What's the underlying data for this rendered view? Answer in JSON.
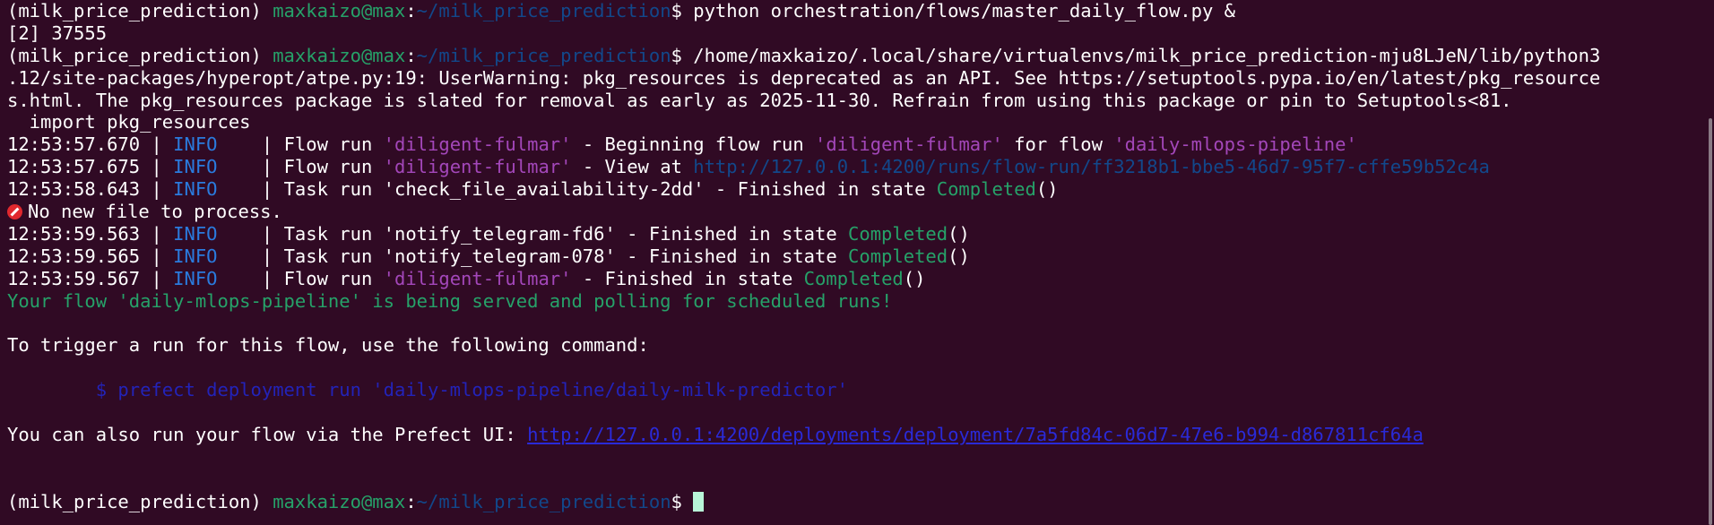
{
  "prompt": {
    "env": "(milk_price_prediction) ",
    "userhost": "maxkaizo@max",
    "colon": ":",
    "path": "~/milk_price_prediction",
    "dollar": "$ "
  },
  "lines": {
    "l1_cmd": "python orchestration/flows/master_daily_flow.py &",
    "l2_job": "[2] 37555",
    "l3_cmd": "/home/maxkaizo/.local/share/virtualenvs/milk_price_prediction-mju8LJeN/lib/python3",
    "l4": ".12/site-packages/hyperopt/atpe.py:19: UserWarning: pkg_resources is deprecated as an API. See https://setuptools.pypa.io/en/latest/pkg_resource",
    "l5": "s.html. The pkg_resources package is slated for removal as early as 2025-11-30. Refrain from using this package or pin to Setuptools<81.",
    "l6": "  import pkg_resources",
    "log1": {
      "time": "12:53:57.670 | ",
      "level": "INFO",
      "sep": "    | Flow run ",
      "name": "'diligent-fulmar'",
      "mid": " - Beginning flow run ",
      "name2": "'diligent-fulmar'",
      "mid2": " for flow ",
      "flow": "'daily-mlops-pipeline'"
    },
    "log2": {
      "time": "12:53:57.675 | ",
      "level": "INFO",
      "sep": "    | Flow run ",
      "name": "'diligent-fulmar'",
      "mid": " - View at ",
      "url": "http://127.0.0.1:4200/runs/flow-run/ff3218b1-bbe5-46d7-95f7-cffe59b52c4a"
    },
    "log3": {
      "time": "12:53:58.643 | ",
      "level": "INFO",
      "sep": "    | Task run 'check_file_availability-2dd' - Finished in state ",
      "state": "Completed",
      "tail": "()"
    },
    "nofile": "No new file to process.",
    "log4": {
      "time": "12:53:59.563 | ",
      "level": "INFO",
      "sep": "    | Task run 'notify_telegram-fd6' - Finished in state ",
      "state": "Completed",
      "tail": "()"
    },
    "log5": {
      "time": "12:53:59.565 | ",
      "level": "INFO",
      "sep": "    | Task run 'notify_telegram-078' - Finished in state ",
      "state": "Completed",
      "tail": "()"
    },
    "log6": {
      "time": "12:53:59.567 | ",
      "level": "INFO",
      "sep": "    | Flow run ",
      "name": "'diligent-fulmar'",
      "mid": " - Finished in state ",
      "state": "Completed",
      "tail": "()"
    },
    "served": "Your flow 'daily-mlops-pipeline' is being served and polling for scheduled runs!",
    "trigger": "To trigger a run for this flow, use the following command:",
    "command": "        $ prefect deployment run 'daily-mlops-pipeline/daily-milk-predictor'",
    "ui_prefix": "You can also run your flow via the Prefect UI: ",
    "ui_url": "http://127.0.0.1:4200/deployments/deployment/7a5fd84c-06d7-47e6-b994-d867811cf64a"
  },
  "colors": {
    "background": "#300a24",
    "prompt_user": "#26a269",
    "prompt_path": "#12488b",
    "info": "#2a7bde",
    "name": "#a347ba",
    "completed": "#26a269"
  }
}
